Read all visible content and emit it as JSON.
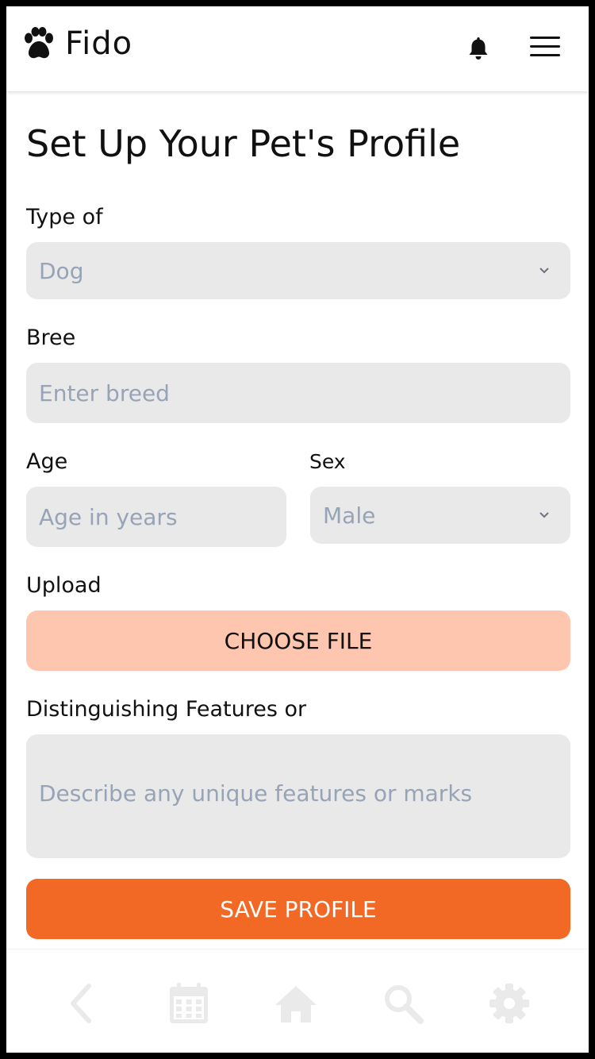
{
  "app": {
    "name": "Fido"
  },
  "page": {
    "title": "Set Up Your Pet's Profile"
  },
  "form": {
    "type": {
      "label": "Type of",
      "value": "Dog"
    },
    "breed": {
      "label": "Bree",
      "placeholder": "Enter breed"
    },
    "age": {
      "label": "Age",
      "placeholder": "Age in years"
    },
    "sex": {
      "label": "Sex",
      "value": "Male"
    },
    "upload": {
      "label": "Upload",
      "button": "CHOOSE FILE"
    },
    "features": {
      "label": "Distinguishing Features or",
      "placeholder": "Describe any unique features or marks"
    },
    "save": "SAVE PROFILE"
  },
  "icons": {
    "logo": "paw-icon",
    "notifications": "bell-icon",
    "menu": "hamburger-menu-icon",
    "nav": [
      "back-icon",
      "calendar-icon",
      "home-icon",
      "search-icon",
      "settings-icon"
    ]
  },
  "colors": {
    "accent": "#f26825",
    "accent_light": "#fec6ae",
    "field_bg": "#e9e9e9",
    "placeholder": "#97a3b6",
    "nav_icon": "#eaeaea"
  }
}
